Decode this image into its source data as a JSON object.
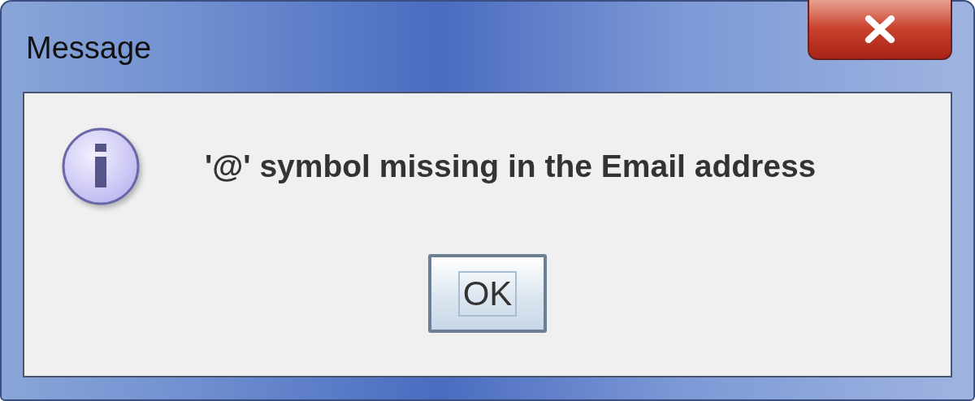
{
  "window": {
    "title": "Message"
  },
  "message": "'@' symbol missing in the Email address",
  "buttons": [
    {
      "label": "OK",
      "focused": true
    }
  ]
}
